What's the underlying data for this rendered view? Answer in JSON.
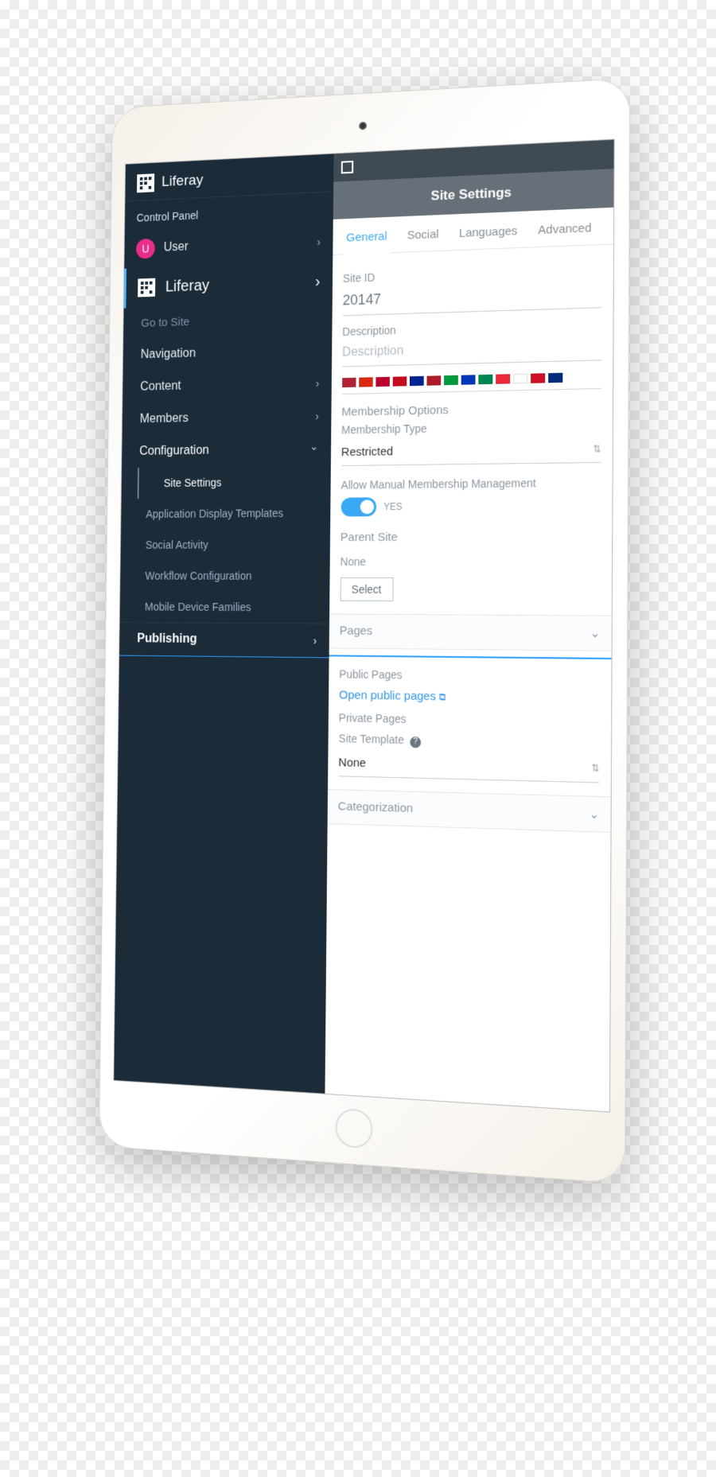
{
  "brand": {
    "name": "Liferay"
  },
  "sidebar": {
    "section_label": "Control Panel",
    "user": {
      "initial": "U",
      "label": "User"
    },
    "primary": {
      "label": "Liferay"
    },
    "go_to_site": "Go to Site",
    "items": [
      {
        "label": "Navigation"
      },
      {
        "label": "Content"
      },
      {
        "label": "Members"
      },
      {
        "label": "Configuration"
      }
    ],
    "config_children": [
      {
        "label": "Site Settings",
        "active": true
      },
      {
        "label": "Application Display Templates"
      },
      {
        "label": "Social Activity"
      },
      {
        "label": "Workflow Configuration"
      },
      {
        "label": "Mobile Device Families"
      }
    ],
    "publishing": "Publishing"
  },
  "content": {
    "heading": "Site Settings",
    "tabs": [
      {
        "label": "General",
        "active": true
      },
      {
        "label": "Social"
      },
      {
        "label": "Languages"
      },
      {
        "label": "Advanced"
      }
    ],
    "site_id_label": "Site ID",
    "site_id_value": "20147",
    "description_label": "Description",
    "description_placeholder": "Description",
    "membership_options_title": "Membership Options",
    "membership_type_label": "Membership Type",
    "membership_type_value": "Restricted",
    "allow_manual_label": "Allow Manual Membership Management",
    "allow_manual_yes": "YES",
    "parent_site_title": "Parent Site",
    "parent_site_value": "None",
    "select_button": "Select",
    "pages_header": "Pages",
    "public_pages_label": "Public Pages",
    "open_public_pages": "Open public pages",
    "private_pages_label": "Private Pages",
    "site_template_label": "Site Template",
    "site_template_value": "None",
    "categorization_header": "Categorization"
  },
  "flags": [
    "#b22234",
    "#de2910",
    "#bc002d",
    "#c60b1e",
    "#002395",
    "#ae1c28",
    "#009c3b",
    "#0038b8",
    "#008751",
    "#ed2939",
    "#ffffff",
    "#ce1126",
    "#002b7f"
  ]
}
